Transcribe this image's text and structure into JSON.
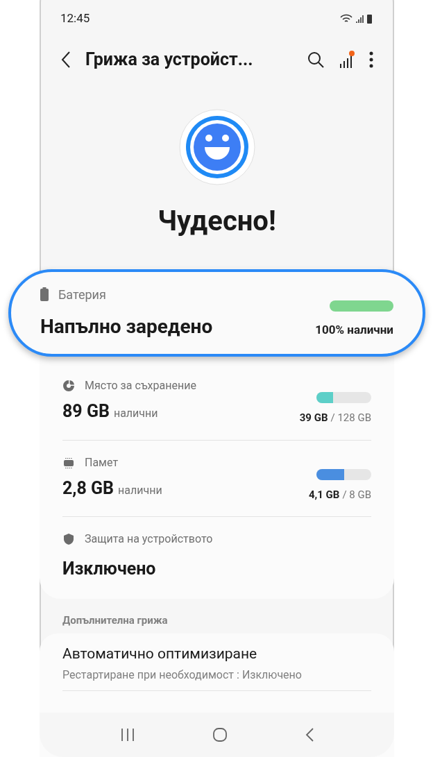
{
  "status_bar": {
    "time": "12:45"
  },
  "header": {
    "title": "Грижа за устройст...",
    "diagnostics_badge": true
  },
  "summary": {
    "status": "Чудесно!"
  },
  "battery": {
    "label": "Батерия",
    "value": "Напълно заредено",
    "level": 1.0,
    "reading": "100% налични"
  },
  "items": [
    {
      "kind": "bar",
      "label": "Място за съхранение",
      "value": "89 GB",
      "unit": "налични",
      "level": 0.3,
      "used": "39 GB",
      "total": "/ 128 GB",
      "color": "#5dcfc8"
    },
    {
      "kind": "bar",
      "label": "Памет",
      "value": "2,8 GB",
      "unit": "налични",
      "level": 0.51,
      "used": "4,1 GB",
      "total": "/ 8 GB",
      "color": "#4a8ee0"
    },
    {
      "kind": "plain",
      "label": "Защита на устройството",
      "value": "Изключено"
    }
  ],
  "additional": {
    "heading": "Допълнителна грижа",
    "items": [
      {
        "title": "Автоматично оптимизиране",
        "subtitle": "Рестартиране при необходимост : Изключено"
      }
    ]
  }
}
